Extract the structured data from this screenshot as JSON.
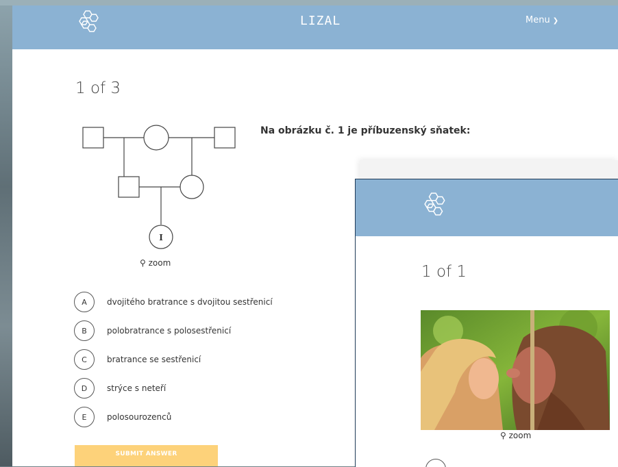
{
  "header": {
    "title": "LIZAL",
    "menu_label": "Menu"
  },
  "quiz": {
    "counter": "1 of 3",
    "question": "Na obrázku č. 1 je příbuzenský sňatek:",
    "zoom_label": "zoom",
    "pedigree_marker": "I",
    "options": [
      {
        "letter": "A",
        "text": "dvojitého bratrance s dvojitou sestřenicí"
      },
      {
        "letter": "B",
        "text": "polobratrance s polosestřenicí"
      },
      {
        "letter": "C",
        "text": "bratrance se sestřenicí"
      },
      {
        "letter": "D",
        "text": "strýce s neteří"
      },
      {
        "letter": "E",
        "text": "polosourozenců"
      }
    ],
    "submit_label": "SUBMIT ANSWER"
  },
  "overlay": {
    "counter": "1 of 1",
    "zoom_label": "zoom"
  },
  "colors": {
    "header": "#8bb2d3",
    "submit": "#fdd27a"
  }
}
